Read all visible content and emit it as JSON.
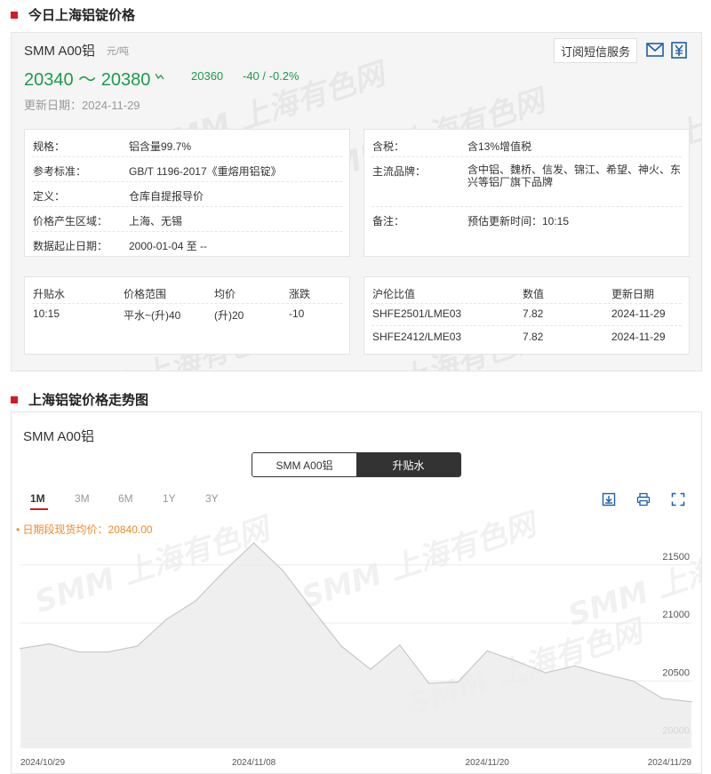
{
  "section1": {
    "title": "今日上海铝锭价格"
  },
  "product": {
    "name": "SMM A00铝",
    "unit": "元/吨",
    "price_range": "20340 ～ 20380",
    "avg": "20360",
    "change": "-40  /  -0.2%",
    "update_date": "更新日期：2024-11-29"
  },
  "subscribe_label": "订阅短信服务",
  "icons": {
    "mail": "mail-icon",
    "yuan": "yuan-icon"
  },
  "watermark": "SMM 上海有色网",
  "spec_left": [
    {
      "label": "规格：",
      "value": "铝含量99.7%"
    },
    {
      "label": "参考标准：",
      "value": "GB/T 1196-2017《重熔用铝锭》"
    },
    {
      "label": "定义：",
      "value": "仓库自提报导价"
    },
    {
      "label": "价格产生区域：",
      "value": "上海、无锡"
    },
    {
      "label": "数据起止日期：",
      "value": "2000-01-04 至 --"
    }
  ],
  "spec_right": [
    {
      "label": "含税：",
      "value": "含13%增值税"
    },
    {
      "label": "主流品牌：",
      "value": "含中铝、魏桥、信发、锦江、希望、神火、东兴等铝厂旗下品牌"
    },
    {
      "label": "备注：",
      "value": "预估更新时间：10:15"
    }
  ],
  "premium_table": {
    "headers": [
      "升贴水",
      "价格范围",
      "均价",
      "涨跌"
    ],
    "row": [
      "10:15",
      "平水~(升)40",
      "(升)20",
      "-10"
    ]
  },
  "ratio_table": {
    "headers": [
      "沪伦比值",
      "数值",
      "更新日期"
    ],
    "rows": [
      [
        "SHFE2501/LME03",
        "7.82",
        "2024-11-29"
      ],
      [
        "SHFE2412/LME03",
        "7.82",
        "2024-11-29"
      ]
    ]
  },
  "section2": {
    "title": "上海铝锭价格走势图"
  },
  "chart_panel": {
    "title": "SMM A00铝",
    "toggle": [
      "SMM A00铝",
      "升贴水"
    ],
    "ranges": [
      "1M",
      "3M",
      "6M",
      "1Y",
      "3Y"
    ],
    "active_range": "1M",
    "avg_label": "• 日期段现货均价：20840.00"
  },
  "chart_data": {
    "type": "area",
    "x": [
      "2024/10/29",
      "2024/10/30",
      "2024/10/31",
      "2024/11/01",
      "2024/11/04",
      "2024/11/05",
      "2024/11/06",
      "2024/11/07",
      "2024/11/08",
      "2024/11/11",
      "2024/11/12",
      "2024/11/13",
      "2024/11/14",
      "2024/11/15",
      "2024/11/18",
      "2024/11/19",
      "2024/11/20",
      "2024/11/21",
      "2024/11/22",
      "2024/11/25",
      "2024/11/26",
      "2024/11/27",
      "2024/11/28",
      "2024/11/29"
    ],
    "values": [
      20780,
      20820,
      20750,
      20750,
      20800,
      21030,
      21190,
      21450,
      21690,
      21450,
      21120,
      20800,
      20600,
      20810,
      20480,
      20490,
      20760,
      20670,
      20570,
      20630,
      20560,
      20500,
      20350,
      20320
    ],
    "x_tick_labels": [
      "2024/10/29",
      "2024/11/08",
      "2024/11/20",
      "2024/11/29"
    ],
    "y_ticks": [
      20000,
      20500,
      21000,
      21500
    ],
    "ylim": [
      19920,
      21820
    ],
    "grid": true,
    "color": "#c8c8c8",
    "fill": "#ececec"
  }
}
